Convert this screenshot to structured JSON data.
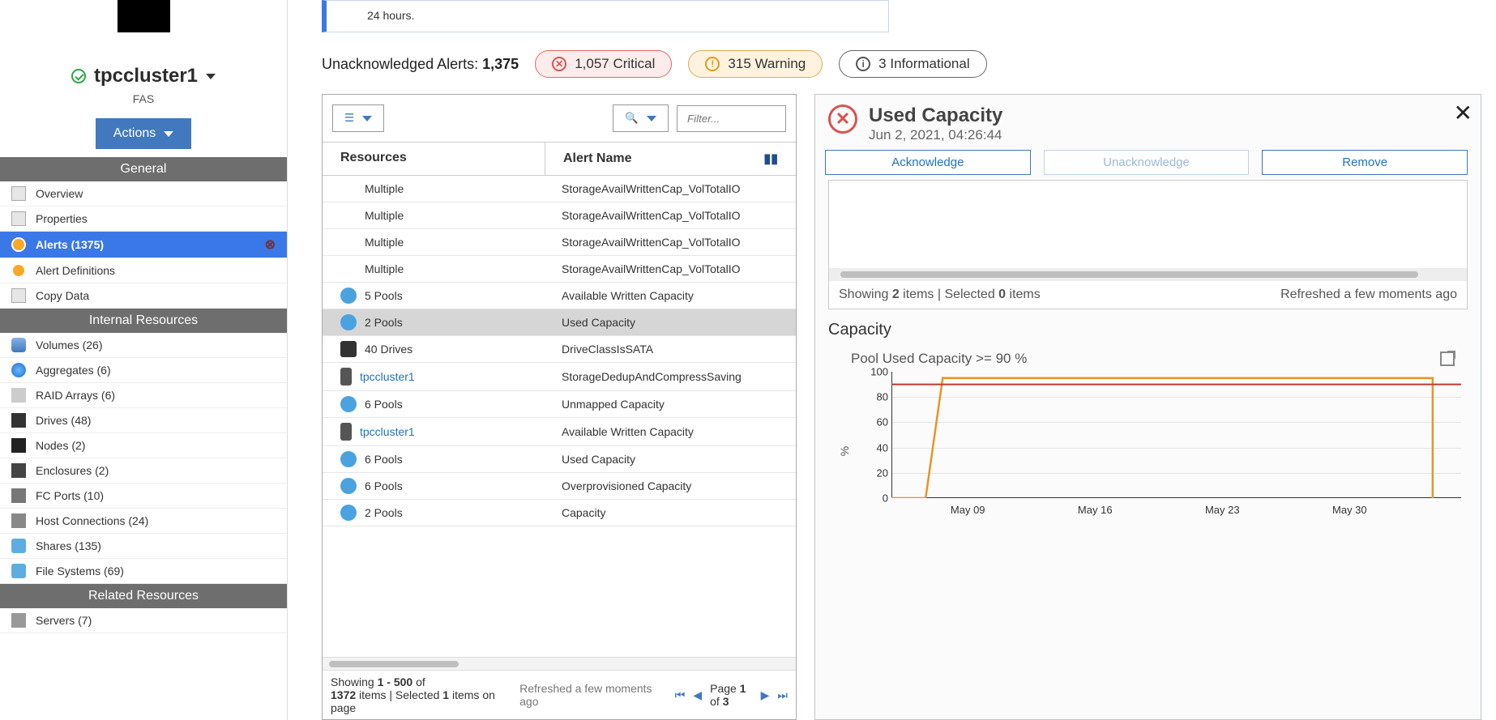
{
  "cluster": {
    "name": "tpccluster1",
    "type": "FAS",
    "actions_label": "Actions"
  },
  "info_box": "24 hours.",
  "alerts_summary": {
    "label": "Unacknowledged Alerts:",
    "total": "1,375",
    "critical": "1,057 Critical",
    "warning": "315 Warning",
    "informational": "3 Informational"
  },
  "sections": {
    "general": "General",
    "internal": "Internal Resources",
    "related": "Related Resources"
  },
  "nav": {
    "overview": "Overview",
    "properties": "Properties",
    "alerts": "Alerts (1375)",
    "alert_defs": "Alert Definitions",
    "copy_data": "Copy Data",
    "volumes": "Volumes (26)",
    "aggregates": "Aggregates (6)",
    "raid": "RAID Arrays (6)",
    "drives": "Drives (48)",
    "nodes": "Nodes (2)",
    "enclosures": "Enclosures (2)",
    "fc_ports": "FC Ports (10)",
    "host_conn": "Host Connections (24)",
    "shares": "Shares (135)",
    "filesystems": "File Systems (69)",
    "servers": "Servers (7)"
  },
  "table": {
    "filter_placeholder": "Filter...",
    "col_resources": "Resources",
    "col_alert": "Alert Name",
    "rows": [
      {
        "icon": "none",
        "res": "Multiple",
        "alert": "StorageAvailWrittenCap_VolTotalIO"
      },
      {
        "icon": "none",
        "res": "Multiple",
        "alert": "StorageAvailWrittenCap_VolTotalIO"
      },
      {
        "icon": "none",
        "res": "Multiple",
        "alert": "StorageAvailWrittenCap_VolTotalIO"
      },
      {
        "icon": "none",
        "res": "Multiple",
        "alert": "StorageAvailWrittenCap_VolTotalIO"
      },
      {
        "icon": "pool",
        "res": "5 Pools",
        "alert": "Available Written Capacity"
      },
      {
        "icon": "pool",
        "res": "2 Pools",
        "alert": "Used Capacity",
        "selected": true
      },
      {
        "icon": "drive",
        "res": "40 Drives",
        "alert": "DriveClassIsSATA"
      },
      {
        "icon": "srv",
        "res": "tpccluster1",
        "alert": "StorageDedupAndCompressSaving",
        "link": true
      },
      {
        "icon": "pool",
        "res": "6 Pools",
        "alert": "Unmapped Capacity"
      },
      {
        "icon": "srv",
        "res": "tpccluster1",
        "alert": "Available Written Capacity",
        "link": true
      },
      {
        "icon": "pool",
        "res": "6 Pools",
        "alert": "Used Capacity"
      },
      {
        "icon": "pool",
        "res": "6 Pools",
        "alert": "Overprovisioned Capacity"
      },
      {
        "icon": "pool",
        "res": "2 Pools",
        "alert": "Capacity"
      }
    ],
    "footer_showing_a": "Showing ",
    "footer_range": "1 - 500",
    "footer_showing_b": " of ",
    "footer_total": "1372",
    "footer_showing_c": " items | Selected ",
    "footer_sel": "1",
    "footer_showing_d": " items on page",
    "footer_refreshed": "Refreshed a few moments ago",
    "page_a": "Page ",
    "page_cur": "1",
    "page_b": " of ",
    "page_tot": "3"
  },
  "detail": {
    "title": "Used Capacity",
    "timestamp": "Jun 2, 2021, 04:26:44",
    "ack": "Acknowledge",
    "unack": "Unacknowledge",
    "remove": "Remove",
    "status_a": "Showing ",
    "status_n1": "2",
    "status_b": " items | Selected ",
    "status_n2": "0",
    "status_c": " items",
    "status_refreshed": "Refreshed a few moments ago",
    "cap_header": "Capacity",
    "chart_title": "Pool Used Capacity >= 90 %"
  },
  "chart_data": {
    "type": "line",
    "title": "Pool Used Capacity >= 90 %",
    "ylabel": "%",
    "xlabel": "",
    "ylim": [
      0,
      100
    ],
    "y_ticks": [
      0,
      20,
      40,
      60,
      80,
      100
    ],
    "x_tick_labels": [
      "May 09",
      "May 16",
      "May 23",
      "May 30"
    ],
    "threshold": 90,
    "series": [
      {
        "name": "pool_used_pct",
        "color": "#e8942a",
        "x": [
          0,
          0.06,
          0.09,
          0.95,
          0.95
        ],
        "y": [
          0,
          0,
          95,
          95,
          0
        ]
      },
      {
        "name": "threshold_90",
        "color": "#c0392b",
        "x": [
          0,
          1.0
        ],
        "y": [
          90,
          90
        ]
      }
    ]
  }
}
